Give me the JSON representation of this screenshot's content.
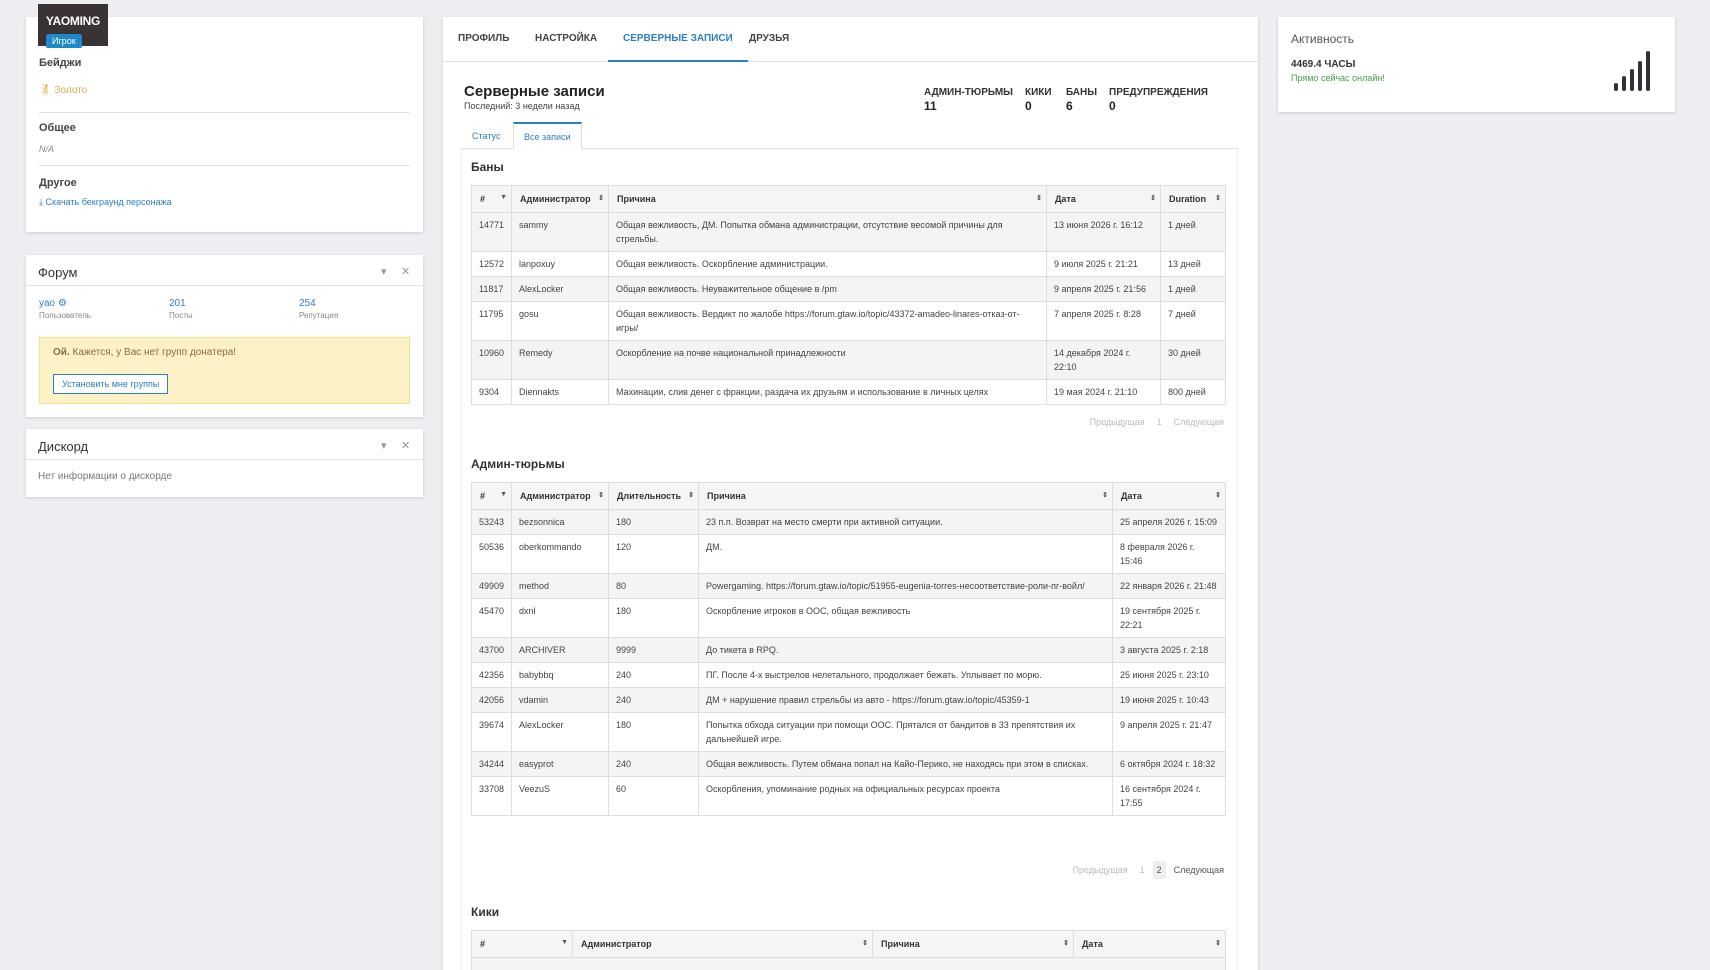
{
  "profile": {
    "avatar_text": "YAOMING",
    "role": "Игрок",
    "badges_heading": "Бейджи",
    "badge_gold": "Золото",
    "general_heading": "Общее",
    "general_value": "N/A",
    "other_heading": "Другое",
    "download_link": "Скачать бекграунд персонажа"
  },
  "forum": {
    "title": "Форум",
    "user_value": "yao",
    "user_label": "Пользователь",
    "posts_value": "201",
    "posts_label": "Посты",
    "rep_value": "254",
    "rep_label": "Репутация",
    "alert_bold": "Ой.",
    "alert_text": " Кажется, у Вас нет групп донатера!",
    "alert_button": "Установить мне группы"
  },
  "discord": {
    "title": "Дискорд",
    "empty": "Нет информации о дискорде"
  },
  "activity": {
    "title": "Активность",
    "hours": "4469.4 ЧАСЫ",
    "online": "Прямо сейчас онлайн!",
    "signal_level": 5
  },
  "nav": {
    "tabs": [
      "Профиль",
      "Настройка",
      "Серверные записи",
      "Друзья"
    ],
    "active": "Серверные записи"
  },
  "records": {
    "title": "Серверные записи",
    "last": "Последний: 3 недели назад",
    "summary": [
      {
        "label": "АДМИН-ТЮРЬМЫ",
        "value": "11"
      },
      {
        "label": "КИКИ",
        "value": "0"
      },
      {
        "label": "БАНЫ",
        "value": "6"
      },
      {
        "label": "ПРЕДУПРЕЖДЕНИЯ",
        "value": "0"
      }
    ],
    "sub_tabs": [
      "Статус",
      "Все записи"
    ]
  },
  "bans": {
    "title": "Баны",
    "headers": [
      "#",
      "Администратор",
      "Причина",
      "Дата",
      "Duration"
    ],
    "rows": [
      [
        "14771",
        "sammy",
        "Общая вежливость, ДМ. Попытка обмана администрации, отсутствие весомой причины для стрельбы.",
        "13 июня 2026 г. 16:12",
        "1 дней"
      ],
      [
        "12572",
        "lanpoxuy",
        "Общая вежливость. Оскорбление администрации.",
        "9 июля 2025 г. 21:21",
        "13 дней"
      ],
      [
        "11817",
        "AlexLocker",
        "Общая вежливость. Неуважительное общение в /pm",
        "9 апреля 2025 г. 21:56",
        "1 дней"
      ],
      [
        "11795",
        "gosu",
        "Общая вежливость. Вердикт по жалобе https://forum.gtaw.io/topic/43372-amadeo-linares-отказ-от-игры/",
        "7 апреля 2025 г. 8:28",
        "7 дней"
      ],
      [
        "10960",
        "Remedy",
        "Оскорбление на почве национальной принадлежности",
        "14 декабря 2024 г. 22:10",
        "30 дней"
      ],
      [
        "9304",
        "Diennakts",
        "Махинации, слив денег с фракции, раздача их друзьям и использование в личных целях",
        "19 мая 2024 г. 21:10",
        "800 дней"
      ]
    ],
    "pager": {
      "prev": "Предыдущая",
      "pages": [
        "1"
      ],
      "next": "Следующая"
    }
  },
  "jails": {
    "title": "Админ-тюрьмы",
    "headers": [
      "#",
      "Администратор",
      "Длительность",
      "Причина",
      "Дата"
    ],
    "rows": [
      [
        "53243",
        "bezsonnica",
        "180",
        "23 п.п. Возврат на место смерти при активной ситуации.",
        "25 апреля 2026 г. 15:09"
      ],
      [
        "50536",
        "oberkommando",
        "120",
        "ДМ.",
        "8 февраля 2026 г. 15:46"
      ],
      [
        "49909",
        "method",
        "80",
        "Powergaming. https://forum.gtaw.io/topic/51955-eugenia-torres-несоответствие-роли-пг-войл/",
        "22 января 2026 г. 21:48"
      ],
      [
        "45470",
        "dxnl",
        "180",
        "Оскорбление игроков в ООС, общая вежливость",
        "19 сентября 2025 г. 22:21"
      ],
      [
        "43700",
        "ARCHIVER",
        "9999",
        "До тикета в RPQ.",
        "3 августа 2025 г. 2:18"
      ],
      [
        "42356",
        "babybbq",
        "240",
        "ПГ. После 4-х выстрелов нелетального, продолжает бежать. Уплывает по морю.",
        "25 июня 2025 г. 23:10"
      ],
      [
        "42056",
        "vdamin",
        "240",
        "ДМ + нарушение правил стрельбы из авто - https://forum.gtaw.io/topic/45359-1",
        "19 июня 2025 г. 10:43"
      ],
      [
        "39674",
        "AlexLocker",
        "180",
        "Попытка обхода ситуации при помощи ООС. Прятался от бандитов в 33 препятствия их дальнейшей игре.",
        "9 апреля 2025 г. 21:47"
      ],
      [
        "34244",
        "easyprot",
        "240",
        "Общая вежливость. Путем обмана попал на Кайо-Перико, не находясь при этом в списках.",
        "6 октября 2024 г. 18:32"
      ],
      [
        "33708",
        "VeezuS",
        "60",
        "Оскорбления, упоминание родных на официальных ресурсах проекта",
        "16 сентября 2024 г. 17:55"
      ]
    ],
    "pager": {
      "prev": "Предыдущая",
      "pages": [
        "1",
        "2"
      ],
      "next": "Следующая"
    }
  },
  "kicks": {
    "title": "Кики",
    "headers": [
      "#",
      "Администратор",
      "Причина",
      "Дата"
    ]
  }
}
